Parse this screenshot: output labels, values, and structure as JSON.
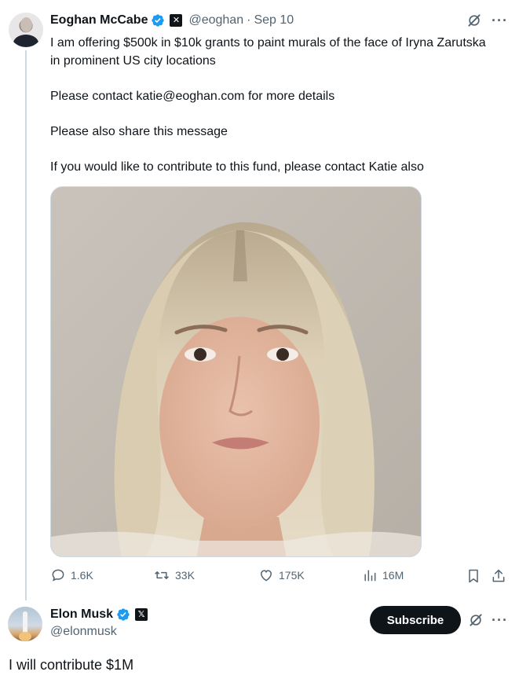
{
  "tweet1": {
    "author_name": "Eoghan McCabe",
    "handle": "@eoghan",
    "separator": "·",
    "date": "Sep 10",
    "affiliate_badge": "✕",
    "more_label": "···",
    "paragraphs": [
      "I am offering $500k in $10k grants to paint murals of the face of Iryna Zarutska in prominent US city locations",
      "Please contact katie@eoghan.com for more details",
      "Please also share this message",
      "If you would like to contribute to this fund, please contact Katie also"
    ],
    "stats": {
      "replies": "1.6K",
      "reposts": "33K",
      "likes": "175K",
      "views": "16M"
    }
  },
  "tweet2": {
    "author_name": "Elon Musk",
    "handle": "@elonmusk",
    "affiliate_badge": "𝕏",
    "subscribe_label": "Subscribe",
    "more_label": "···",
    "text": "I will contribute $1M"
  },
  "colors": {
    "text_primary": "#0f1419",
    "text_secondary": "#536471",
    "verified_blue": "#1d9bf0",
    "button_dark": "#0f1419",
    "thread_line": "#cfd9de"
  },
  "icons": [
    "verified-badge-icon",
    "grok-icon",
    "more-icon",
    "reply-icon",
    "repost-icon",
    "like-icon",
    "views-icon",
    "bookmark-icon",
    "share-icon"
  ]
}
